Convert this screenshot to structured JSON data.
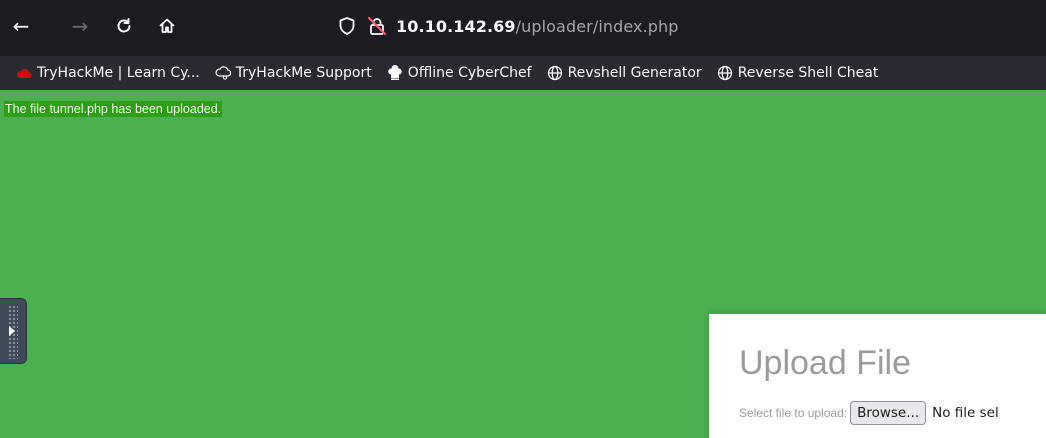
{
  "browser": {
    "nav": {
      "back_icon": "←",
      "forward_icon": "→"
    },
    "url": {
      "host": "10.10.142.69",
      "path": "/uploader/index.php"
    },
    "bookmarks": [
      {
        "label": "TryHackMe | Learn Cy...",
        "icon": "tryhackme-cloud-icon"
      },
      {
        "label": "TryHackMe Support",
        "icon": "support-cloud-icon"
      },
      {
        "label": "Offline CyberChef",
        "icon": "chef-hat-icon"
      },
      {
        "label": "Revshell Generator",
        "icon": "globe-icon"
      },
      {
        "label": "Reverse Shell Cheat",
        "icon": "globe-icon"
      }
    ]
  },
  "page": {
    "upload_message": "The file tunnel.php has been uploaded.",
    "upload_form": {
      "title": "Upload File",
      "select_label": "Select file to upload:",
      "browse_label": "Browse...",
      "file_status": "No file sel"
    }
  },
  "colors": {
    "page_background": "#4caf50",
    "message_background": "#2e9e15",
    "toolbar_background": "#1c1b22",
    "bookmarks_background": "#2b2a33"
  }
}
